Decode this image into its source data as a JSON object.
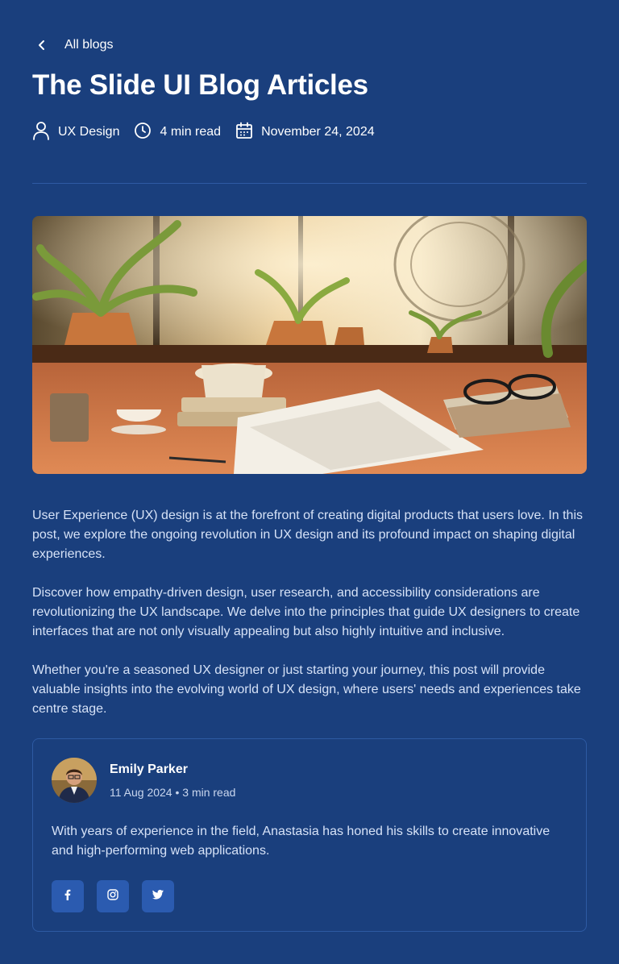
{
  "nav": {
    "back_label": "All blogs"
  },
  "post": {
    "title": "The Slide UI Blog Articles",
    "category": "UX Design",
    "read_time": "4 min read",
    "date": "November 24, 2024",
    "paragraphs": [
      "User Experience (UX) design is at the forefront of creating digital products that users love. In this post, we explore the ongoing revolution in UX design and its profound impact on shaping digital experiences.",
      "Discover how empathy-driven design, user research, and accessibility considerations are revolutionizing the UX landscape. We delve into the principles that guide UX designers to create interfaces that are not only visually appealing but also highly intuitive and inclusive.",
      "Whether you're a seasoned UX designer or just starting your journey, this post will provide valuable insights into the evolving world of UX design, where users' needs and experiences take centre stage."
    ]
  },
  "author": {
    "name": "Emily Parker",
    "meta": "11 Aug 2024 • 3 min read",
    "bio": "With years of experience in the field, Anastasia has honed his skills to create innovative and high-performing web applications.",
    "socials": [
      "facebook-icon",
      "instagram-icon",
      "twitter-icon"
    ]
  },
  "colors": {
    "background": "#1a3f7d",
    "divider": "#2e5aa3",
    "social_button": "#2b5bb0"
  }
}
